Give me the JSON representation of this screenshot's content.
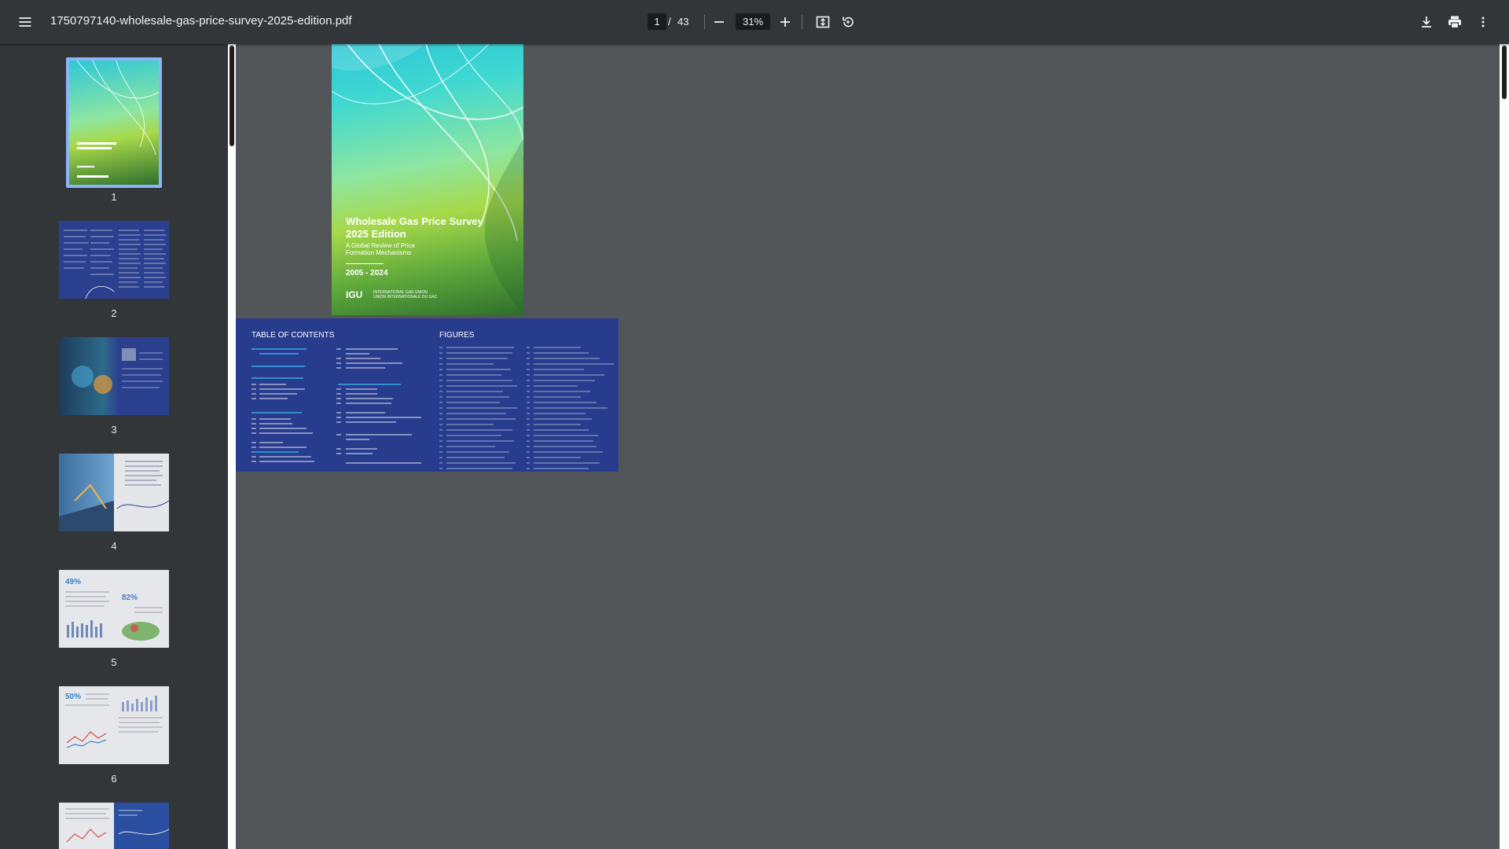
{
  "toolbar": {
    "menu_icon": "menu-icon",
    "filename": "1750797140-wholesale-gas-price-survey-2025-edition.pdf",
    "current_page": "1",
    "page_separator": "/",
    "total_pages": "43",
    "zoom": "31%",
    "icons": [
      "zoom-out-icon",
      "zoom-in-icon",
      "fit-page-icon",
      "rotate-icon",
      "download-icon",
      "print-icon",
      "more-vert-icon"
    ]
  },
  "sidebar": {
    "thumbnails": [
      {
        "page": "1",
        "selected": true
      },
      {
        "page": "2"
      },
      {
        "page": "3"
      },
      {
        "page": "4"
      },
      {
        "page": "5"
      },
      {
        "page": "6"
      },
      {
        "page": "7"
      }
    ]
  },
  "document": {
    "cover": {
      "title": "Wholesale Gas Price Survey 2025 Edition",
      "subtitle": "A Global Review of Price Formation Mechanisms",
      "years": "2005 - 2024",
      "logo": "IGU",
      "org_en": "INTERNATIONAL GAS UNION",
      "org_fr": "UNION INTERNATIONALE DU GAZ"
    },
    "toc": {
      "heading_left": "TABLE OF CONTENTS",
      "heading_right": "FIGURES"
    }
  },
  "colors": {
    "toolbar_bg": "#323639",
    "viewer_bg": "#525659",
    "toc_bg": "#283c8e",
    "selected_thumb_border": "#8ab4f8"
  }
}
